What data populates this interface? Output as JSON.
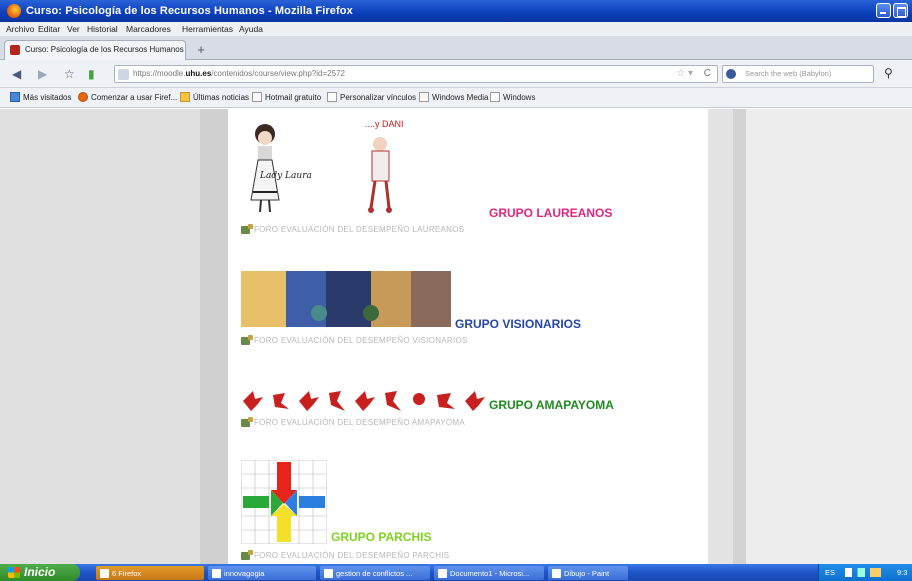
{
  "window": {
    "title": "Curso: Psicología de los Recursos Humanos - Mozilla Firefox"
  },
  "menu": [
    "Archivo",
    "Editar",
    "Ver",
    "Historial",
    "Marcadores",
    "Herramientas",
    "Ayuda"
  ],
  "tab": {
    "label": "Curso: Psicología de los Recursos Humanos",
    "new_tab": "+"
  },
  "nav": {
    "url_prefix": "https://moodle.",
    "url_host": "uhu.es",
    "url_rest": "/contenidos/course/view.php?id=2572",
    "search_placeholder": "Search the web (Babylon)"
  },
  "bookmarks": [
    {
      "label": "Más visitados",
      "icon": "folder-icon"
    },
    {
      "label": "Comenzar a usar Firef...",
      "icon": "firefox-icon"
    },
    {
      "label": "Últimas noticias",
      "icon": "rss-icon"
    },
    {
      "label": "Hotmail gratuito",
      "icon": "page-icon"
    },
    {
      "label": "Personalizar vínculos",
      "icon": "page-icon"
    },
    {
      "label": "Windows Media",
      "icon": "page-icon"
    },
    {
      "label": "Windows",
      "icon": "page-icon"
    }
  ],
  "content": {
    "signature_text": "Lady Laura",
    "dani_text": "....y DANI",
    "groups": [
      {
        "title": "GRUPO LAUREANOS",
        "color": "#e0267e",
        "forum": "FORO EVALUACIÓN DEL DESEMPEÑO LAUREANOS"
      },
      {
        "title": "GRUPO VISIONARIOS",
        "color": "#2546a8",
        "forum": "FORO EVALUACIÓN DEL DESEMPEÑO VISIONARIOS"
      },
      {
        "title": "GRUPO AMAPAYOMA",
        "color": "#1f8a1f",
        "forum": "FORO EVALUACIÓN DEL DESEMPEÑO AMAPAYOMA"
      },
      {
        "title": "GRUPO PARCHIS",
        "color": "#7ed321",
        "forum": "FORO EVALUACIÓN DEL DESEMPEÑO PARCHIS"
      }
    ]
  },
  "taskbar": {
    "start": "Inicio",
    "tasks": [
      "6 Firefox",
      "innovagogia",
      "gestion de conflictos ...",
      "Documento1 - Microsi...",
      "Dibujo - Paint"
    ],
    "tray_lang": "ES",
    "tray_time": "9:3"
  }
}
